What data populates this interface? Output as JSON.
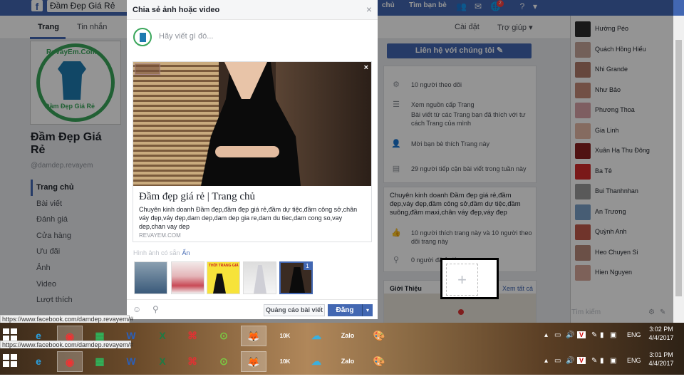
{
  "topbar": {
    "logo": "f",
    "page_title": "Đầm Đẹp Giá Rẻ",
    "links": [
      "chủ",
      "Tìm bạn bè"
    ],
    "notif_count": "2",
    "help": "?"
  },
  "tabs": [
    "Trang",
    "Tin nhắn",
    "Cài đặt",
    "Trợ giúp ▾"
  ],
  "page": {
    "logo_text_top": "ReVayEm.Com",
    "logo_text_bottom": "Đầm Đẹp Giá Rẻ",
    "name": "Đầm Đẹp Giá Rẻ",
    "handle": "@damdep.revayem"
  },
  "left_nav": [
    "Trang chủ",
    "Bài viết",
    "Đánh giá",
    "Cửa hàng",
    "Ưu đãi",
    "Ảnh",
    "Video",
    "Lượt thích"
  ],
  "right_column": {
    "contact_button": "Liên hệ với chúng tôi ✎",
    "followers": "10 người theo dõi",
    "source_title": "Xem nguồn cấp Trang",
    "source_desc": "Bài viết từ các Trang bạn đã thích với tư cách Trang của mình",
    "invite": "Mời bạn bè thích Trang này",
    "reach": "29 người tiếp cận bài viết trong tuần này",
    "about": "Chuyên kinh doanh Đầm đẹp giá rẻ,đầm đẹp,váy đẹp,đầm công sở,đầm dự tiệc,đầm suông,đầm maxi,chân váy đẹp,váy đẹp",
    "likes": "10 người thích trang này và 10 người theo dõi trang này",
    "checkins": "0 người đã ở đây",
    "intro_title": "Giới Thiệu",
    "see_all": "Xem tất cả"
  },
  "chat": {
    "contacts": [
      "Hường Péo",
      "Quách Hồng Hiếu",
      "Nhi Grande",
      "Như Bảo",
      "Phương Thoa",
      "Gia Linh",
      "Xuân Hạ Thu Đông",
      "Ba Tê",
      "Bui Thanhnhan",
      "An Trương",
      "Quỳnh Anh",
      "Heo Chuyen Si",
      "Hien Nguyen"
    ],
    "avatar_colors": [
      "#2c2c2c",
      "#c7a59a",
      "#b07a6a",
      "#c58a78",
      "#d9a3a8",
      "#e6b8a6",
      "#8a2020",
      "#d22b2b",
      "#999",
      "#7aa0c8",
      "#c25a4a",
      "#b98a7a",
      "#d7a89a"
    ],
    "search_placeholder": "Tìm kiếm"
  },
  "modal": {
    "title": "Chia sẻ ảnh hoặc video",
    "close": "×",
    "placeholder": "Hãy viết gì đó...",
    "preview_close": "×",
    "link_title": "Đầm đẹp giá rẻ | Trang chủ",
    "link_desc": "Chuyên kinh doanh Đầm đẹp,đầm đẹp giá rẻ,đầm dự tiệc,đầm công sở,chân váy đẹp,váy đẹp,dam dep,dam dep gia re,dam du tiec,dam cong so,vay dep,chan vay dep",
    "link_domain": "REVAYEM.COM",
    "available_label": "Hình ảnh có sẵn",
    "available_hide": "Ẩn",
    "thumb3_text": "THỜI TRANG GIÁ",
    "selected_count": "1",
    "add_plus": "+",
    "boost_button": "Quảng cáo bài viết",
    "post_button": "Đăng",
    "post_dropdown": "▾"
  },
  "status_url": "https://www.facebook.com/damdep.revayem/#",
  "status_url_2": "https://www.facebook.com/damdep.revayem/#",
  "taskbar": {
    "lang": "ENG",
    "time_1": "3:02 PM",
    "date_1": "4/4/2017",
    "time_2": "3:01 PM",
    "date_2": "4/4/2017",
    "apps": [
      "e",
      "◉",
      "▦",
      "W",
      "X",
      "⌘",
      "⊙",
      "🦊",
      "10K",
      "☁",
      "Zalo",
      "🎨"
    ]
  }
}
